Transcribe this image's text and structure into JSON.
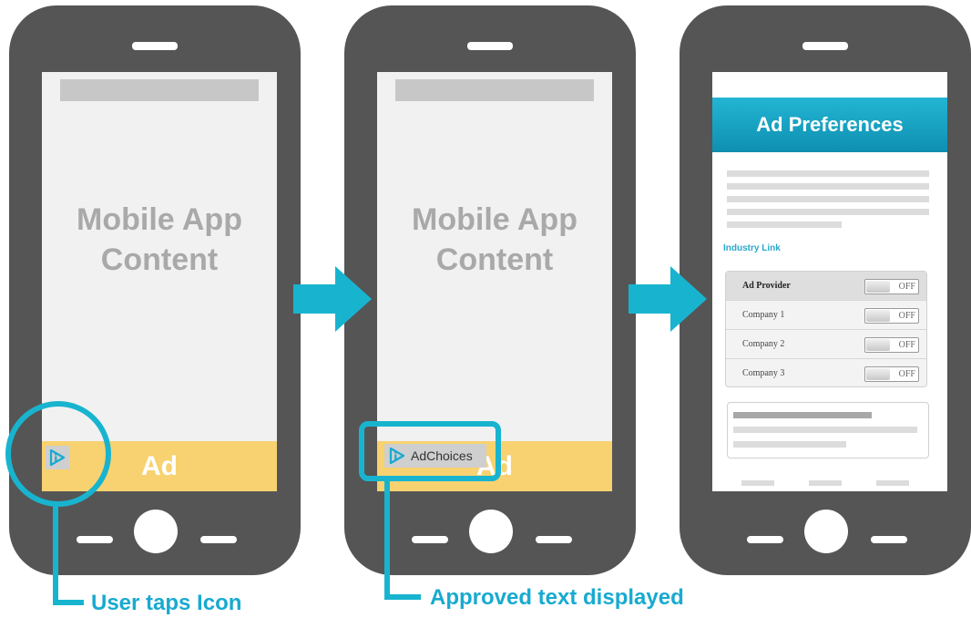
{
  "phone1": {
    "content_title_line1": "Mobile App",
    "content_title_line2": "Content",
    "ad_label": "Ad"
  },
  "phone2": {
    "content_title_line1": "Mobile App",
    "content_title_line2": "Content",
    "ad_label": "Ad",
    "adchoices_text": "AdChoices"
  },
  "phone3": {
    "header_title": "Ad Preferences",
    "industry_link": "Industry Link",
    "providers": [
      {
        "name": "Ad Provider",
        "toggle": "OFF"
      },
      {
        "name": "Company 1",
        "toggle": "OFF"
      },
      {
        "name": "Company 2",
        "toggle": "OFF"
      },
      {
        "name": "Company 3",
        "toggle": "OFF"
      }
    ]
  },
  "captions": {
    "step1": "User taps Icon",
    "step2": "Approved text displayed"
  },
  "colors": {
    "accent": "#18b4cf",
    "phone_body": "#555555",
    "ad_bar": "#f8d270",
    "header": "#1aa6c8"
  },
  "icons": {
    "flow_arrow": "arrow-right-icon",
    "adchoices": "adchoices-icon"
  }
}
